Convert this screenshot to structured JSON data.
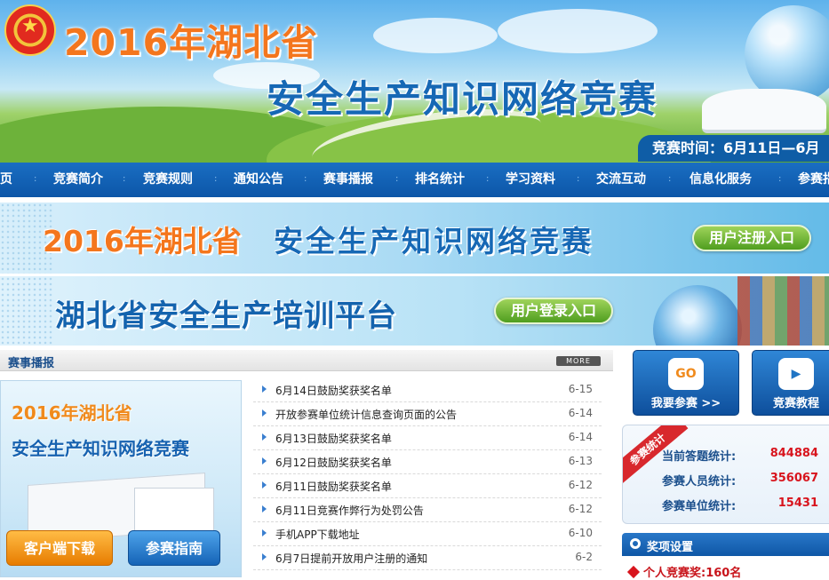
{
  "header": {
    "title_year": "2016年湖北省",
    "title_main": "安全生产知识网络竞赛",
    "time_text": "竞赛时间：6月11日—6月"
  },
  "nav": {
    "items": [
      "页",
      "竞赛简介",
      "竞赛规则",
      "通知公告",
      "赛事播报",
      "排名统计",
      "学习资料",
      "交流互动",
      "信息化服务",
      "参赛指"
    ]
  },
  "banner1": {
    "title_year": "2016年湖北省",
    "title_main": "安全生产知识网络竞赛",
    "button": "用户注册入口"
  },
  "banner2": {
    "title": "湖北省安全生产培训平台",
    "button": "用户登录入口"
  },
  "news": {
    "section_title": "赛事播报",
    "more_label": "MORE",
    "items": [
      {
        "text": "6月14日鼓励奖获奖名单",
        "date": "6-15"
      },
      {
        "text": "开放参赛单位统计信息查询页面的公告",
        "date": "6-14"
      },
      {
        "text": "6月13日鼓励奖获奖名单",
        "date": "6-14"
      },
      {
        "text": "6月12日鼓励奖获奖名单",
        "date": "6-13"
      },
      {
        "text": "6月11日鼓励奖获奖名单",
        "date": "6-12"
      },
      {
        "text": "6月11日竞赛作弊行为处罚公告",
        "date": "6-12"
      },
      {
        "text": "手机APP下载地址",
        "date": "6-10"
      },
      {
        "text": "6月7日提前开放用户注册的通知",
        "date": "6-2"
      }
    ]
  },
  "promo": {
    "title_year": "2016年湖北省",
    "title_main": "安全生产知识网络竞赛",
    "client_download": "客户端下载",
    "guide": "参赛指南"
  },
  "tiles": {
    "join": {
      "icon_text": "GO",
      "label": "我要参赛 >>"
    },
    "tutorial": {
      "label": "竞赛教程"
    }
  },
  "stats": {
    "ribbon": "参赛统计",
    "rows": [
      {
        "label": "当前答题统计:",
        "value": "844884"
      },
      {
        "label": "参赛人员统计:",
        "value": "356067"
      },
      {
        "label": "参赛单位统计:",
        "value": "15431"
      }
    ]
  },
  "awards": {
    "title": "奖项设置",
    "first_line": "个人竞赛奖:160名"
  },
  "colors": {
    "nav_blue": "#0c56a8",
    "title_orange": "#f4761d",
    "title_blue": "#1668b5",
    "stat_red": "#d8141d",
    "button_green": "#4f9e1f"
  }
}
